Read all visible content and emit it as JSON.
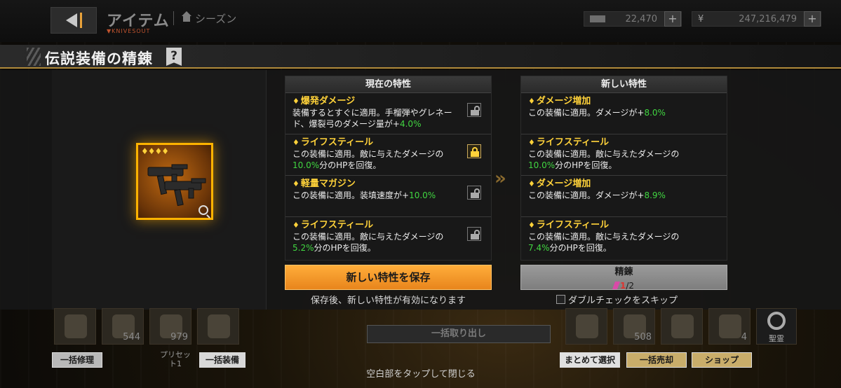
{
  "topbar": {
    "title": "アイテム",
    "brand": "▼KNIVESOUT",
    "breadcrumb": "シーズン",
    "currency1": "22,470",
    "currency2_symbol": "¥",
    "currency2": "247,216,479",
    "plus": "+"
  },
  "modal": {
    "title": "伝説装備の精錬",
    "help": "?"
  },
  "item": {
    "rarity": "♦♦♦♦"
  },
  "current": {
    "header": "現在の特性",
    "traits": [
      {
        "name": "爆発ダメージ",
        "desc_a": "装備するとすぐに適用。手榴弾やグレネード、爆裂弓のダメージ量が+",
        "value": "4.0%",
        "desc_b": "",
        "lock": "open"
      },
      {
        "name": "ライフスティール",
        "desc_a": "この装備に適用。敵に与えたダメージの\n",
        "value": "10.0%",
        "desc_b": "分のHPを回復。",
        "lock": "locked"
      },
      {
        "name": "軽量マガジン",
        "desc_a": "この装備に適用。装填速度が+",
        "value": "10.0%",
        "desc_b": "",
        "lock": "open"
      },
      {
        "name": "ライフスティール",
        "desc_a": "この装備に適用。敵に与えたダメージの\n",
        "value": "5.2%",
        "desc_b": "分のHPを回復。",
        "lock": "open"
      }
    ]
  },
  "new": {
    "header": "新しい特性",
    "traits": [
      {
        "name": "ダメージ増加",
        "desc_a": "この装備に適用。ダメージが+",
        "value": "8.0%",
        "desc_b": ""
      },
      {
        "name": "ライフスティール",
        "desc_a": "この装備に適用。敵に与えたダメージの\n",
        "value": "10.0%",
        "desc_b": "分のHPを回復。"
      },
      {
        "name": "ダメージ増加",
        "desc_a": "この装備に適用。ダメージが+",
        "value": "8.9%",
        "desc_b": ""
      },
      {
        "name": "ライフスティール",
        "desc_a": "この装備に適用。敵に与えたダメージの\n",
        "value": "7.4%",
        "desc_b": "分のHPを回復。"
      }
    ]
  },
  "actions": {
    "save": "新しい特性を保存",
    "save_note": "保存後、新しい特性が有効になります",
    "refine": "精錬",
    "refine_have": "1",
    "refine_need": "/2",
    "skip": "ダブルチェックをスキップ"
  },
  "inventory": {
    "slot_counts": [
      "",
      "544",
      "979",
      ""
    ],
    "right_counts": [
      "",
      "508",
      "",
      "4"
    ],
    "eye_label": "聖霊",
    "repair": "一括修理",
    "preset": "プリセット1",
    "equip": "一括装備",
    "bulk_out": "一括取り出し",
    "select": "まとめて選択",
    "sell": "一括売却",
    "shop": "ショップ"
  },
  "close_hint": "空白部をタップして閉じる",
  "colors": {
    "accent": "#e8851c",
    "highlight": "#41d641",
    "trait_name": "#ffd23a"
  }
}
